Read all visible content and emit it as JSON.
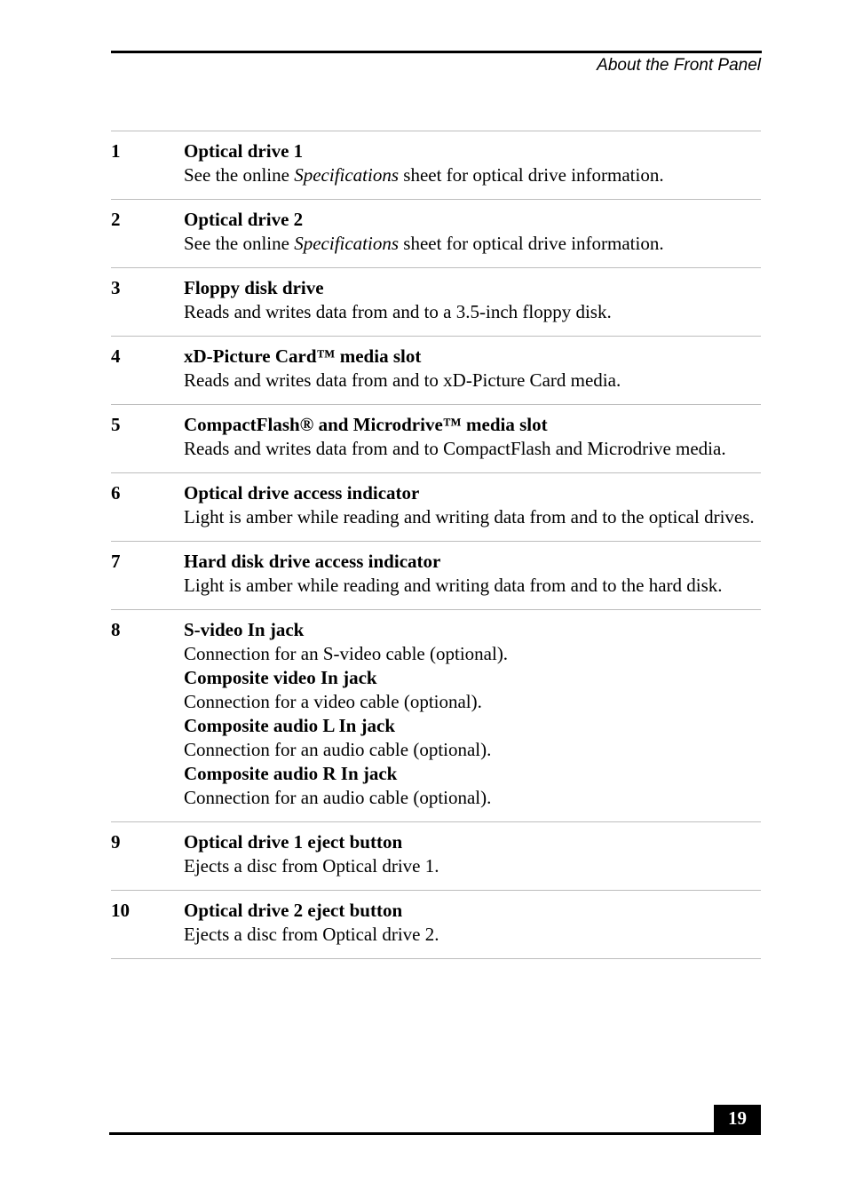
{
  "header": {
    "running_title": "About the Front Panel"
  },
  "items": [
    {
      "number": "1",
      "blocks": [
        {
          "title": "Optical drive 1",
          "desc_pre": "See the online ",
          "desc_em": "Specifications",
          "desc_post": " sheet for optical drive information."
        }
      ]
    },
    {
      "number": "2",
      "blocks": [
        {
          "title": "Optical drive 2",
          "desc_pre": "See the online ",
          "desc_em": "Specifications",
          "desc_post": " sheet for optical drive information."
        }
      ]
    },
    {
      "number": "3",
      "blocks": [
        {
          "title": "Floppy disk drive",
          "desc_pre": "Reads and writes data from and to a 3.5-inch floppy disk."
        }
      ]
    },
    {
      "number": "4",
      "blocks": [
        {
          "title": "xD-Picture Card™ media slot",
          "desc_pre": "Reads and writes data from and to xD-Picture Card media."
        }
      ]
    },
    {
      "number": "5",
      "blocks": [
        {
          "title": "CompactFlash® and Microdrive™ media slot",
          "desc_pre": "Reads and writes data from and to CompactFlash and Microdrive media."
        }
      ]
    },
    {
      "number": "6",
      "blocks": [
        {
          "title": "Optical drive access indicator",
          "desc_pre": "Light is amber while reading and writing data from and to the optical drives."
        }
      ]
    },
    {
      "number": "7",
      "blocks": [
        {
          "title": "Hard disk drive access indicator",
          "desc_pre": "Light is amber while reading and writing data from and to the hard disk."
        }
      ]
    },
    {
      "number": "8",
      "blocks": [
        {
          "title": "S-video In jack",
          "desc_pre": "Connection for an S-video cable (optional)."
        },
        {
          "title": "Composite video In jack",
          "desc_pre": "Connection for a video cable (optional)."
        },
        {
          "title": "Composite audio L In jack",
          "desc_pre": "Connection for an audio cable (optional)."
        },
        {
          "title": "Composite audio R In jack",
          "desc_pre": "Connection for an audio cable (optional)."
        }
      ]
    },
    {
      "number": "9",
      "blocks": [
        {
          "title": "Optical drive 1 eject button",
          "desc_pre": "Ejects a disc from Optical drive 1."
        }
      ]
    },
    {
      "number": "10",
      "blocks": [
        {
          "title": "Optical drive 2 eject button",
          "desc_pre": "Ejects a disc from Optical drive 2."
        }
      ]
    }
  ],
  "footer": {
    "page_number": "19"
  }
}
